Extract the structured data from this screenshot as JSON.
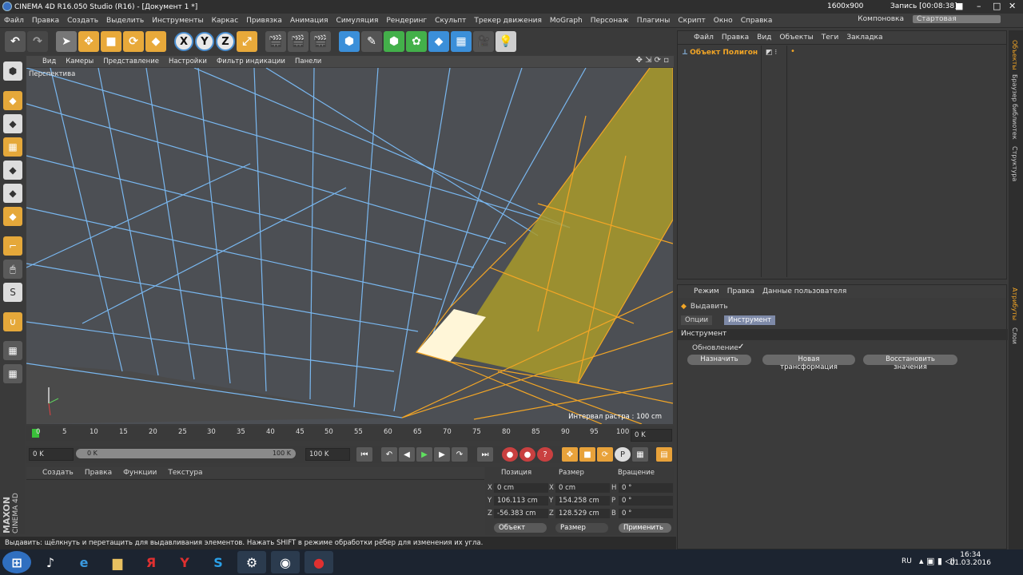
{
  "titlebar": {
    "title": "CINEMA 4D R16.050 Studio (R16) - [Документ 1 *]",
    "resolution": "1600x900",
    "recording": "Запись [00:08:38]"
  },
  "menu": [
    "Файл",
    "Правка",
    "Создать",
    "Выделить",
    "Инструменты",
    "Каркас",
    "Привязка",
    "Анимация",
    "Симуляция",
    "Рендеринг",
    "Скульпт",
    "Трекер движения",
    "MoGraph",
    "Персонаж",
    "Плагины",
    "Скрипт",
    "Окно",
    "Справка"
  ],
  "layout": {
    "label": "Компоновка",
    "value": "Стартовая"
  },
  "viewport": {
    "menu": [
      "Вид",
      "Камеры",
      "Представление",
      "Настройки",
      "Фильтр индикации",
      "Панели"
    ],
    "name": "Перспектива",
    "grid_label": "Интервал растра : 100 cm"
  },
  "timeline": {
    "ticks": [
      "0",
      "5",
      "10",
      "15",
      "20",
      "25",
      "30",
      "35",
      "40",
      "45",
      "50",
      "55",
      "60",
      "65",
      "70",
      "75",
      "80",
      "85",
      "90",
      "95",
      "100"
    ],
    "current": "0 K"
  },
  "playback": {
    "start": "0 K",
    "range_start": "0 K",
    "range_end": "100 K",
    "end": "100 K"
  },
  "material": {
    "menu": [
      "Создать",
      "Правка",
      "Функции",
      "Текстура"
    ]
  },
  "coords": {
    "headers": [
      "Позиция",
      "Размер",
      "Вращение"
    ],
    "rows": [
      {
        "axis": "X",
        "pos": "0 cm",
        "size_axis": "X",
        "size": "0 cm",
        "rot_axis": "H",
        "rot": "0 °"
      },
      {
        "axis": "Y",
        "pos": "106.113 cm",
        "size_axis": "Y",
        "size": "154.258 cm",
        "rot_axis": "P",
        "rot": "0 °"
      },
      {
        "axis": "Z",
        "pos": "-56.383 cm",
        "size_axis": "Z",
        "size": "128.529 cm",
        "rot_axis": "B",
        "rot": "0 °"
      }
    ],
    "mode": "Объект",
    "size_mode": "Размер",
    "apply": "Применить"
  },
  "status": "Выдавить: щёлкнуть и перетащить для выдавливания элементов. Нажать SHIFT в режиме обработки рёбер для изменения их угла.",
  "objects": {
    "menu": [
      "Файл",
      "Правка",
      "Вид",
      "Объекты",
      "Теги",
      "Закладка"
    ],
    "item": "Объект Полигон"
  },
  "attributes": {
    "menu": [
      "Режим",
      "Правка",
      "Данные пользователя"
    ],
    "tool": "Выдавить",
    "tabs": [
      "Опции",
      "Инструмент"
    ],
    "section": "Инструмент",
    "update_label": "Обновление",
    "update_check": "✓",
    "buttons": [
      "Назначить",
      "Новая трансформация",
      "Восстановить значения"
    ]
  },
  "sidetabs": [
    "Объекты",
    "Браузер библиотек",
    "Структура",
    "Атрибуты",
    "Слои"
  ],
  "tray": {
    "lang": "RU",
    "time": "16:34",
    "date": "01.03.2016"
  },
  "brand": {
    "maxon": "MAXON",
    "cinema": "CINEMA 4D"
  }
}
